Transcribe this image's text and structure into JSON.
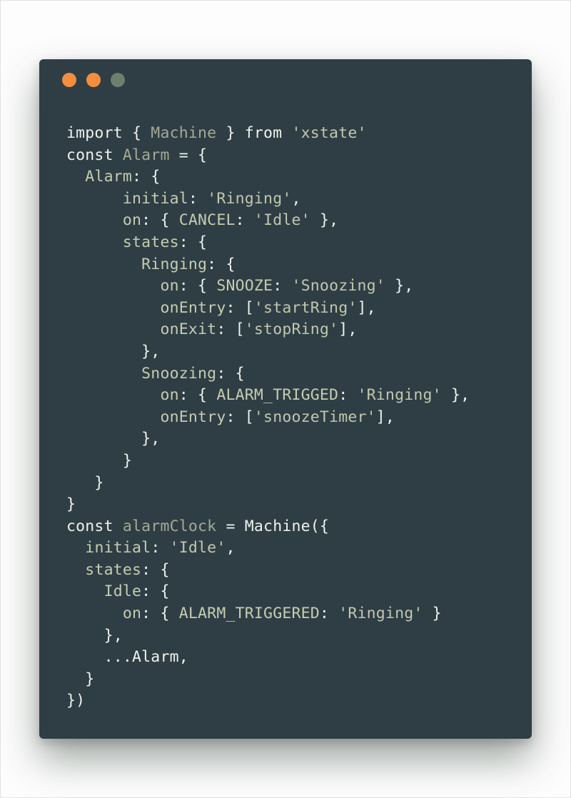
{
  "colors": {
    "page_background": "#ffffff",
    "window_background": "#2f3e45",
    "dot_close": "#f38e3e",
    "dot_minimize": "#f38e3e",
    "dot_maximize": "#6d7f6e",
    "plain": "#eef2ec",
    "prop": "#c6ccb0",
    "ident": "#a3aa93",
    "string": "#c1c7ad"
  },
  "window_controls": [
    {
      "name": "close-dot",
      "color": "#f38e3e"
    },
    {
      "name": "minimize-dot",
      "color": "#f38e3e"
    },
    {
      "name": "maximize-dot",
      "color": "#6d7f6e"
    }
  ],
  "code_lines": [
    [
      {
        "t": "import { ",
        "k": "plain"
      },
      {
        "t": "Machine",
        "k": "ident"
      },
      {
        "t": " } from ",
        "k": "plain"
      },
      {
        "t": "'xstate'",
        "k": "str"
      }
    ],
    [
      {
        "t": "const ",
        "k": "plain"
      },
      {
        "t": "Alarm",
        "k": "ident"
      },
      {
        "t": " = {",
        "k": "plain"
      }
    ],
    [
      {
        "t": "  ",
        "k": "plain"
      },
      {
        "t": "Alarm",
        "k": "prop"
      },
      {
        "t": ": {",
        "k": "plain"
      }
    ],
    [
      {
        "t": "      ",
        "k": "plain"
      },
      {
        "t": "initial",
        "k": "prop"
      },
      {
        "t": ": ",
        "k": "plain"
      },
      {
        "t": "'Ringing'",
        "k": "str"
      },
      {
        "t": ",",
        "k": "plain"
      }
    ],
    [
      {
        "t": "      ",
        "k": "plain"
      },
      {
        "t": "on",
        "k": "prop"
      },
      {
        "t": ": { ",
        "k": "plain"
      },
      {
        "t": "CANCEL",
        "k": "prop"
      },
      {
        "t": ": ",
        "k": "plain"
      },
      {
        "t": "'Idle'",
        "k": "str"
      },
      {
        "t": " },",
        "k": "plain"
      }
    ],
    [
      {
        "t": "      ",
        "k": "plain"
      },
      {
        "t": "states",
        "k": "prop"
      },
      {
        "t": ": {",
        "k": "plain"
      }
    ],
    [
      {
        "t": "        ",
        "k": "plain"
      },
      {
        "t": "Ringing",
        "k": "prop"
      },
      {
        "t": ": {",
        "k": "plain"
      }
    ],
    [
      {
        "t": "          ",
        "k": "plain"
      },
      {
        "t": "on",
        "k": "prop"
      },
      {
        "t": ": { ",
        "k": "plain"
      },
      {
        "t": "SNOOZE",
        "k": "prop"
      },
      {
        "t": ": ",
        "k": "plain"
      },
      {
        "t": "'Snoozing'",
        "k": "str"
      },
      {
        "t": " },",
        "k": "plain"
      }
    ],
    [
      {
        "t": "          ",
        "k": "plain"
      },
      {
        "t": "onEntry",
        "k": "prop"
      },
      {
        "t": ": [",
        "k": "plain"
      },
      {
        "t": "'startRing'",
        "k": "str"
      },
      {
        "t": "],",
        "k": "plain"
      }
    ],
    [
      {
        "t": "          ",
        "k": "plain"
      },
      {
        "t": "onExit",
        "k": "prop"
      },
      {
        "t": ": [",
        "k": "plain"
      },
      {
        "t": "'stopRing'",
        "k": "str"
      },
      {
        "t": "],",
        "k": "plain"
      }
    ],
    [
      {
        "t": "        },",
        "k": "plain"
      }
    ],
    [
      {
        "t": "        ",
        "k": "plain"
      },
      {
        "t": "Snoozing",
        "k": "prop"
      },
      {
        "t": ": {",
        "k": "plain"
      }
    ],
    [
      {
        "t": "          ",
        "k": "plain"
      },
      {
        "t": "on",
        "k": "prop"
      },
      {
        "t": ": { ",
        "k": "plain"
      },
      {
        "t": "ALARM_TRIGGED",
        "k": "prop"
      },
      {
        "t": ": ",
        "k": "plain"
      },
      {
        "t": "'Ringing'",
        "k": "str"
      },
      {
        "t": " },",
        "k": "plain"
      }
    ],
    [
      {
        "t": "          ",
        "k": "plain"
      },
      {
        "t": "onEntry",
        "k": "prop"
      },
      {
        "t": ": [",
        "k": "plain"
      },
      {
        "t": "'snoozeTimer'",
        "k": "str"
      },
      {
        "t": "],",
        "k": "plain"
      }
    ],
    [
      {
        "t": "        },",
        "k": "plain"
      }
    ],
    [
      {
        "t": "      }",
        "k": "plain"
      }
    ],
    [
      {
        "t": "   }",
        "k": "plain"
      }
    ],
    [
      {
        "t": "}",
        "k": "plain"
      }
    ],
    [
      {
        "t": "const ",
        "k": "plain"
      },
      {
        "t": "alarmClock",
        "k": "ident"
      },
      {
        "t": " = Machine({",
        "k": "plain"
      }
    ],
    [
      {
        "t": "  ",
        "k": "plain"
      },
      {
        "t": "initial",
        "k": "prop"
      },
      {
        "t": ": ",
        "k": "plain"
      },
      {
        "t": "'Idle'",
        "k": "str"
      },
      {
        "t": ",",
        "k": "plain"
      }
    ],
    [
      {
        "t": "  ",
        "k": "plain"
      },
      {
        "t": "states",
        "k": "prop"
      },
      {
        "t": ": {",
        "k": "plain"
      }
    ],
    [
      {
        "t": "    ",
        "k": "plain"
      },
      {
        "t": "Idle",
        "k": "prop"
      },
      {
        "t": ": {",
        "k": "plain"
      }
    ],
    [
      {
        "t": "      ",
        "k": "plain"
      },
      {
        "t": "on",
        "k": "prop"
      },
      {
        "t": ": { ",
        "k": "plain"
      },
      {
        "t": "ALARM_TRIGGERED",
        "k": "prop"
      },
      {
        "t": ": ",
        "k": "plain"
      },
      {
        "t": "'Ringing'",
        "k": "str"
      },
      {
        "t": " }",
        "k": "plain"
      }
    ],
    [
      {
        "t": "    },",
        "k": "plain"
      }
    ],
    [
      {
        "t": "    ...Alarm,",
        "k": "plain"
      }
    ],
    [
      {
        "t": "  }",
        "k": "plain"
      }
    ],
    [
      {
        "t": "})",
        "k": "plain"
      }
    ]
  ]
}
